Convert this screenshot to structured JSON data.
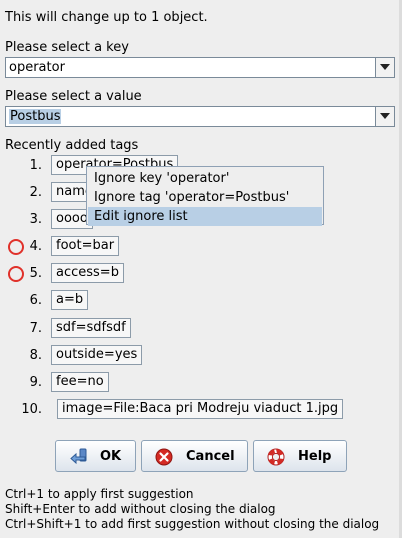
{
  "header": {
    "text": "This will change up to 1 object."
  },
  "key": {
    "label": "Please select a key",
    "value": "operator"
  },
  "value": {
    "label": "Please select a value",
    "value": "Postbus"
  },
  "recent": {
    "label": "Recently added tags",
    "tags": [
      {
        "num": "1.",
        "text": "operator=Postbus"
      },
      {
        "num": "2.",
        "text": "name"
      },
      {
        "num": "3.",
        "text": "oooo"
      },
      {
        "num": "4.",
        "text": "foot=bar"
      },
      {
        "num": "5.",
        "text": "access=b"
      },
      {
        "num": "6.",
        "text": "a=b"
      },
      {
        "num": "7.",
        "text": "sdf=sdfsdf"
      },
      {
        "num": "8.",
        "text": "outside=yes"
      },
      {
        "num": "9.",
        "text": "fee=no"
      },
      {
        "num": "10.",
        "text": "image=File:Baca pri Modreju viaduct 1.jpg"
      }
    ]
  },
  "context_menu": {
    "items": [
      {
        "label": "Ignore key 'operator'"
      },
      {
        "label": "Ignore tag 'operator=Postbus'"
      },
      {
        "label": "Edit ignore list"
      }
    ]
  },
  "buttons": {
    "ok": "OK",
    "cancel": "Cancel",
    "help": "Help"
  },
  "hints": [
    "Ctrl+1 to apply first suggestion",
    "Shift+Enter to add without closing the dialog",
    "Ctrl+Shift+1 to add first suggestion without closing the dialog"
  ],
  "colors": {
    "selection": "#b8cfe5",
    "marker": "#e0312a",
    "cancel_icon": "#d42a24"
  }
}
